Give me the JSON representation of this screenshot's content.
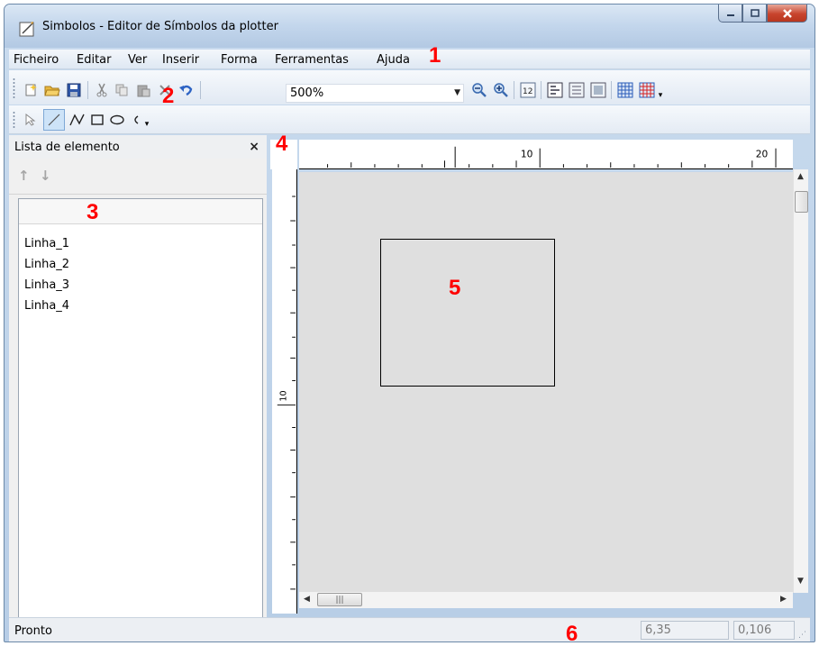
{
  "window": {
    "title": "Simbolos - Editor de Símbolos da plotter",
    "controls": {
      "minimize": "minimize-icon",
      "maximize": "maximize-icon",
      "close": "close-icon"
    }
  },
  "menubar": [
    "Ficheiro",
    "Editar",
    "Ver",
    "Inserir",
    "Forma",
    "Ferramentas",
    "Ajuda"
  ],
  "toolbar": {
    "zoom_value": "500%",
    "icons": [
      "new-file-icon",
      "open-folder-icon",
      "save-icon",
      "cut-icon",
      "copy-icon",
      "paste-icon",
      "delete-icon",
      "undo-icon",
      "zoom-out-icon",
      "zoom-in-icon",
      "zoom-number-icon",
      "fit-icon",
      "properties-icon",
      "image-icon",
      "grid-icon",
      "grid-red-icon"
    ]
  },
  "draw_tools": [
    "pointer-icon",
    "line-icon",
    "polyline-icon",
    "rectangle-icon",
    "ellipse-icon",
    "arc-icon"
  ],
  "element_panel": {
    "title": "Lista de elemento",
    "close": "×",
    "items": [
      "Linha_1",
      "Linha_2",
      "Linha_3",
      "Linha_4"
    ]
  },
  "rulers": {
    "horizontal_labels": [
      "10",
      "20"
    ],
    "vertical_labels": [
      "10"
    ]
  },
  "status": {
    "text": "Pronto",
    "x_value": "6,35",
    "y_value": "0,106"
  },
  "callouts": [
    "1",
    "2",
    "3",
    "4",
    "5",
    "6"
  ],
  "colors": {
    "callout": "#ff0000",
    "canvas": "#dfdfdf"
  }
}
